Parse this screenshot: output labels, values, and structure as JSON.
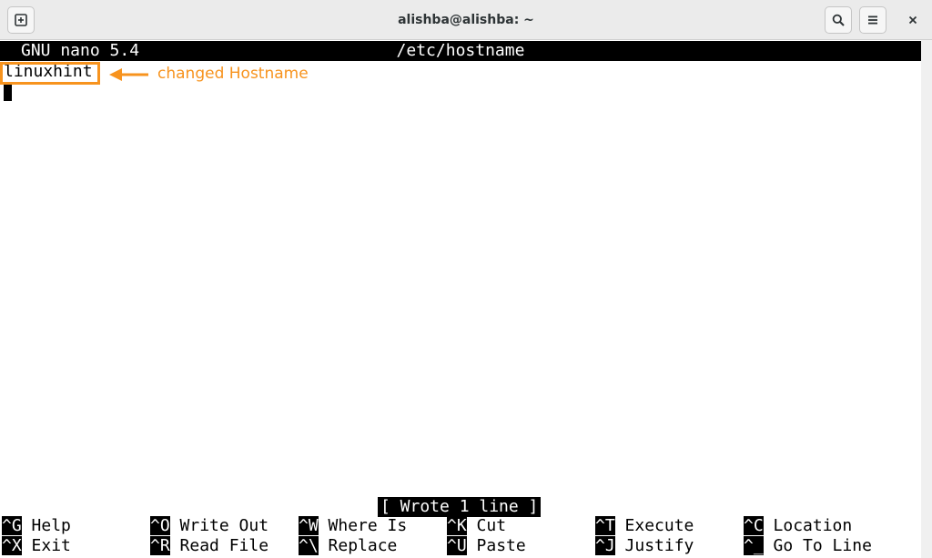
{
  "window": {
    "title": "alishba@alishba: ~",
    "icons": {
      "new_tab": "new-tab-icon",
      "search": "search-icon",
      "menu": "hamburger-menu-icon",
      "close": "close-icon"
    }
  },
  "nano": {
    "version": "GNU nano 5.4",
    "filename": "/etc/hostname",
    "lines": [
      "linuxhint"
    ],
    "status_message": "[ Wrote 1 line ]",
    "shortcuts_row1": [
      {
        "key": "^G",
        "label": "Help"
      },
      {
        "key": "^O",
        "label": "Write Out"
      },
      {
        "key": "^W",
        "label": "Where Is"
      },
      {
        "key": "^K",
        "label": "Cut"
      },
      {
        "key": "^T",
        "label": "Execute"
      },
      {
        "key": "^C",
        "label": "Location"
      }
    ],
    "shortcuts_row2": [
      {
        "key": "^X",
        "label": "Exit"
      },
      {
        "key": "^R",
        "label": "Read File"
      },
      {
        "key": "^\\",
        "label": "Replace"
      },
      {
        "key": "^U",
        "label": "Paste"
      },
      {
        "key": "^J",
        "label": "Justify"
      },
      {
        "key": "^_",
        "label": "Go To Line"
      }
    ]
  },
  "annotation": {
    "text": "changed Hostname",
    "color": "#f7931e"
  }
}
